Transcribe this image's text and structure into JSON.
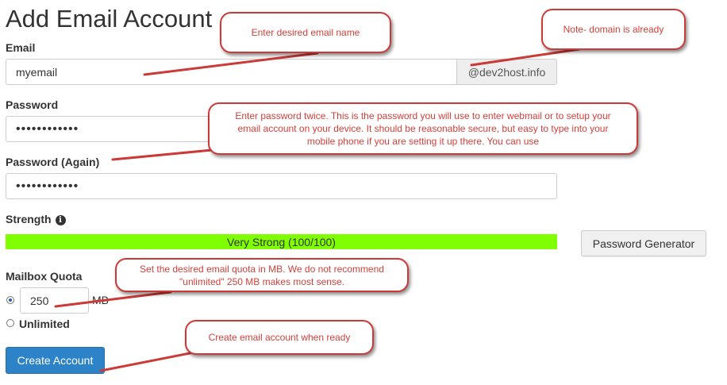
{
  "page": {
    "title": "Add Email Account"
  },
  "email": {
    "label": "Email",
    "value": "myemail",
    "domain": "@dev2host.info"
  },
  "password": {
    "label": "Password",
    "value": "••••••••••••"
  },
  "password_again": {
    "label": "Password (Again)",
    "value": "••••••••••••"
  },
  "strength": {
    "label": "Strength",
    "info_icon": "info-circle-icon",
    "text": "Very Strong (100/100)",
    "level": 1.0,
    "color": "#80ff00"
  },
  "generator": {
    "label": "Password Generator"
  },
  "quota": {
    "label": "Mailbox Quota",
    "value": "250",
    "unit": "MB",
    "unlimited_label": "Unlimited",
    "selected": "limited"
  },
  "create": {
    "label": "Create Account",
    "color": "#2d83c8"
  },
  "callouts": {
    "email_name": "Enter desired email name",
    "domain_note": "Note- domain is already",
    "password_note": "Enter password twice. This is the password you will use to enter webmail or to setup your email account on your device. It should be reasonable secure, but easy to type into your mobile phone if you are setting it up there. You can use",
    "quota_note": "Set the desired email quota in MB. We do not recommend \"unlimited\" 250 MB makes most sense.",
    "create_note": "Create email account when ready",
    "color": "#cc3a37"
  }
}
